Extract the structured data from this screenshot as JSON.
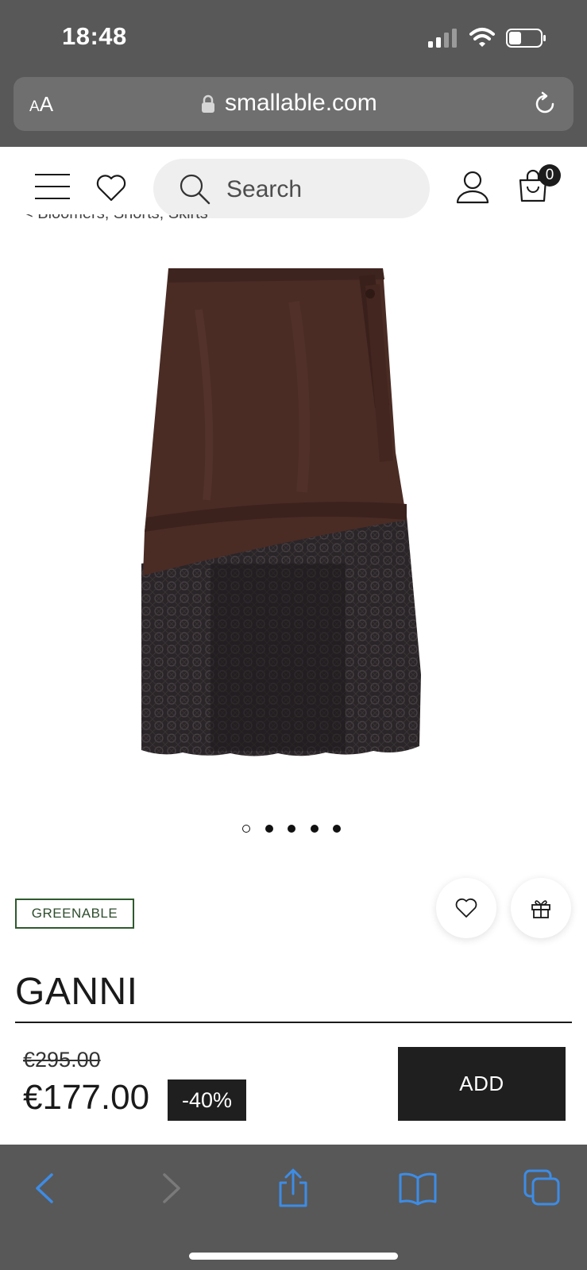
{
  "status_bar": {
    "time": "18:48"
  },
  "browser": {
    "text_size_label_small": "A",
    "text_size_label_large": "A",
    "url": "smallable.com"
  },
  "header": {
    "search_placeholder": "Search",
    "cart_count": "0"
  },
  "breadcrumb": {
    "text": "< Bloomers, Shorts, Skirts"
  },
  "gallery": {
    "image_count": 5,
    "active_index": 0
  },
  "product": {
    "badge": "GREENABLE",
    "brand": "GANNI",
    "old_price": "€295.00",
    "price": "€177.00",
    "discount": "-40%",
    "add_label": "ADD"
  },
  "colors": {
    "chrome": "#585858",
    "accent_dark": "#1f1f1f",
    "greenable": "#2e5a2e",
    "link_blue": "#3d8ce6"
  },
  "icons": [
    "lock-icon",
    "reload-icon",
    "menu-icon",
    "heart-icon",
    "search-icon",
    "user-icon",
    "bag-icon",
    "gift-icon",
    "back-icon",
    "forward-icon",
    "share-icon",
    "bookmarks-icon",
    "tabs-icon"
  ]
}
